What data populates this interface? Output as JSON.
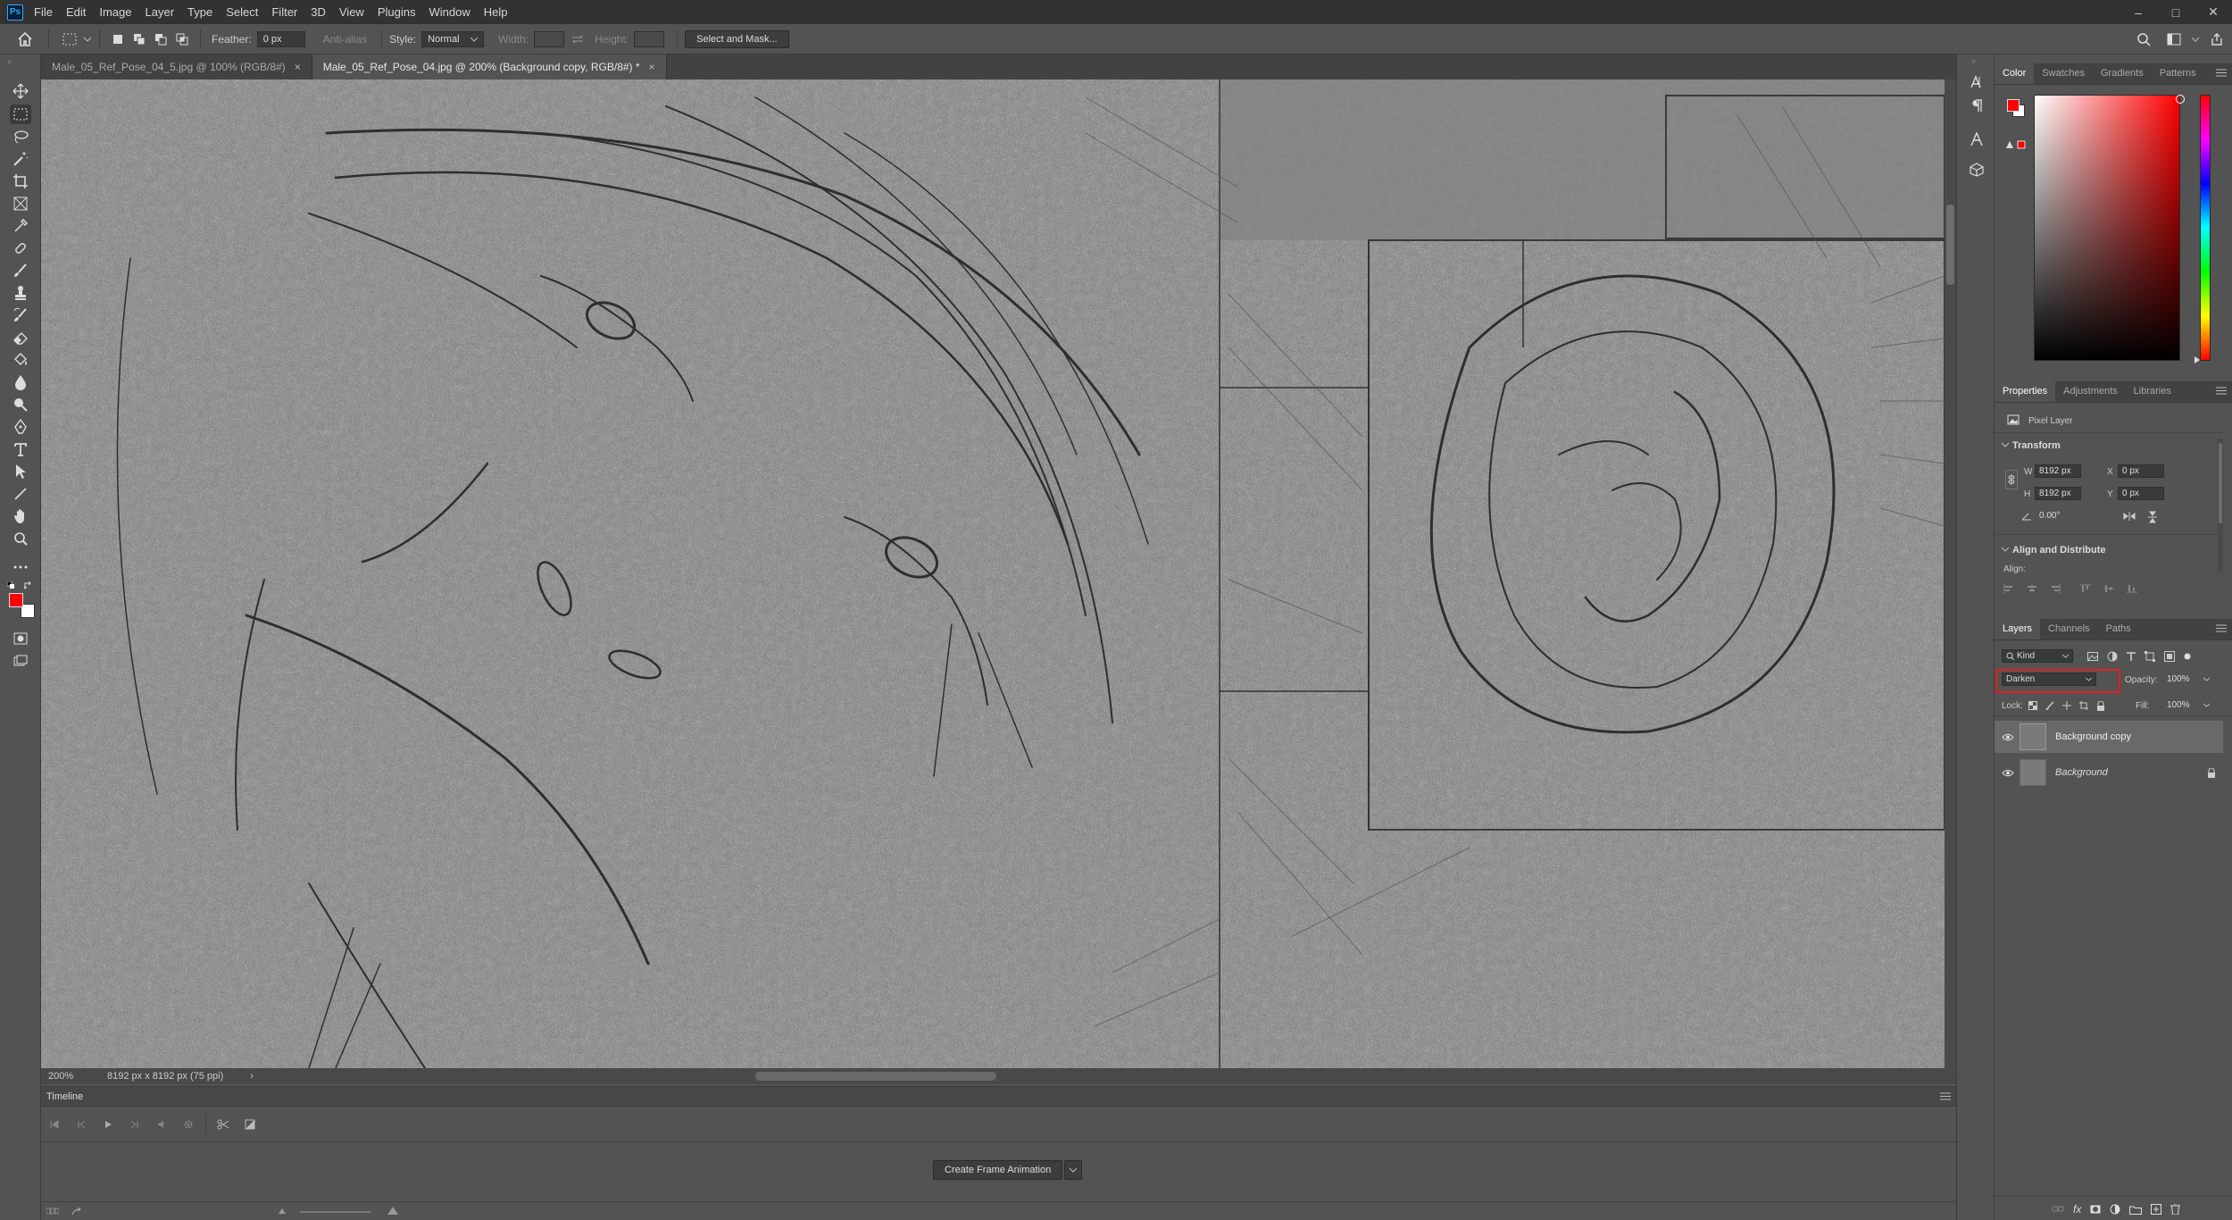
{
  "app": {
    "logo": "Ps"
  },
  "menu": [
    "File",
    "Edit",
    "Image",
    "Layer",
    "Type",
    "Select",
    "Filter",
    "3D",
    "View",
    "Plugins",
    "Window",
    "Help"
  ],
  "options": {
    "feather_label": "Feather:",
    "feather_value": "0 px",
    "antialias": "Anti-alias",
    "style_label": "Style:",
    "style_value": "Normal",
    "width_label": "Width:",
    "height_label": "Height:",
    "select_mask": "Select and Mask..."
  },
  "tabs": [
    {
      "label": "Male_05_Ref_Pose_04_5.jpg @ 100% (RGB/8#)",
      "close": "×"
    },
    {
      "label": "Male_05_Ref_Pose_04.jpg @ 200% (Background copy, RGB/8#) *",
      "close": "×"
    }
  ],
  "status": {
    "zoom": "200%",
    "doc": "8192 px x 8192 px (75 ppi)",
    "arrow": "›"
  },
  "timeline": {
    "title": "Timeline",
    "create_btn": "Create Frame Animation"
  },
  "color_panel": {
    "tabs": [
      "Color",
      "Swatches",
      "Gradients",
      "Patterns"
    ],
    "fg": "#ff0000",
    "bg": "#ffffff"
  },
  "properties": {
    "tabs": [
      "Properties",
      "Adjustments",
      "Libraries"
    ],
    "layer_type": "Pixel Layer",
    "transform": "Transform",
    "w_label": "W",
    "w": "8192 px",
    "h_label": "H",
    "h": "8192 px",
    "x_label": "X",
    "x": "0 px",
    "y_label": "Y",
    "y": "0 px",
    "angle": "0.00°",
    "align_title": "Align and Distribute",
    "align_label": "Align:"
  },
  "layers": {
    "tabs": [
      "Layers",
      "Channels",
      "Paths"
    ],
    "kind": "Kind",
    "blend": "Darken",
    "opacity_label": "Opacity:",
    "opacity": "100%",
    "lock_label": "Lock:",
    "fill_label": "Fill:",
    "fill": "100%",
    "items": [
      {
        "name": "Background copy"
      },
      {
        "name": "Background"
      }
    ],
    "highlight": "#e0201e"
  }
}
